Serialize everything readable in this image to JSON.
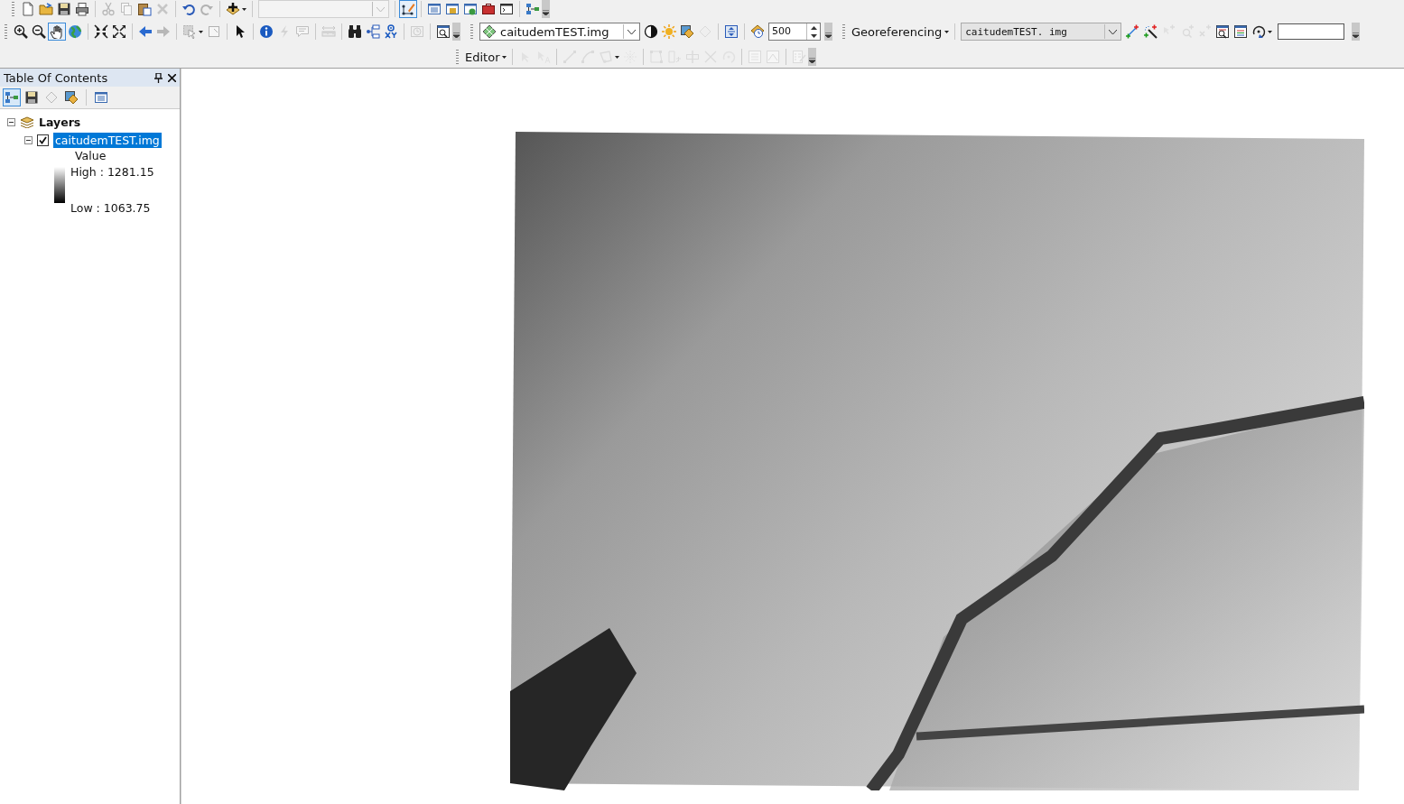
{
  "toolbars": [
    {
      "items": [
        {
          "kind": "grip"
        },
        {
          "kind": "tool",
          "disabled": false,
          "selected": false
        },
        {
          "kind": "tool",
          "disabled": false,
          "selected": false
        },
        {
          "kind": "tool",
          "disabled": false,
          "selected": false
        },
        {
          "kind": "tool",
          "disabled": false,
          "selected": false
        },
        {
          "kind": "sep"
        },
        {
          "kind": "tool",
          "disabled": true,
          "selected": false
        },
        {
          "kind": "tool",
          "disabled": true,
          "selected": false
        },
        {
          "kind": "tool",
          "disabled": false,
          "selected": false
        },
        {
          "kind": "tool",
          "disabled": true,
          "selected": false
        },
        {
          "kind": "sep"
        },
        {
          "kind": "tool",
          "disabled": false,
          "selected": false
        },
        {
          "kind": "tool",
          "disabled": true,
          "selected": false
        },
        {
          "kind": "sep"
        },
        {
          "kind": "dropdown-tool",
          "disabled": false,
          "selected": false
        },
        {
          "kind": "sep"
        },
        {
          "kind": "combo",
          "disabled": true
        },
        {
          "kind": "sep"
        },
        {
          "kind": "tool",
          "disabled": false,
          "selected": true
        },
        {
          "kind": "sep"
        },
        {
          "kind": "tool",
          "disabled": false,
          "selected": false
        },
        {
          "kind": "tool",
          "disabled": false,
          "selected": false
        },
        {
          "kind": "tool",
          "disabled": false,
          "selected": false
        },
        {
          "kind": "tool",
          "disabled": false,
          "selected": false
        },
        {
          "kind": "tool",
          "disabled": false,
          "selected": false
        },
        {
          "kind": "sep"
        },
        {
          "kind": "tool",
          "disabled": false,
          "selected": false
        },
        {
          "kind": "overflow"
        }
      ]
    },
    {
      "items": [
        {
          "kind": "grip"
        },
        {
          "kind": "tool",
          "disabled": false,
          "selected": false
        },
        {
          "kind": "tool",
          "disabled": false,
          "selected": false
        },
        {
          "kind": "tool",
          "disabled": false,
          "selected": true
        },
        {
          "kind": "tool",
          "disabled": false,
          "selected": false
        },
        {
          "kind": "sep"
        },
        {
          "kind": "tool",
          "disabled": false,
          "selected": false
        },
        {
          "kind": "tool",
          "disabled": false,
          "selected": false
        },
        {
          "kind": "sep"
        },
        {
          "kind": "tool",
          "disabled": false,
          "selected": false
        },
        {
          "kind": "tool",
          "disabled": true,
          "selected": false
        },
        {
          "kind": "sep"
        },
        {
          "kind": "dropdown-tool",
          "disabled": true,
          "selected": false
        },
        {
          "kind": "tool",
          "disabled": true,
          "selected": false
        },
        {
          "kind": "sep"
        },
        {
          "kind": "tool",
          "disabled": false,
          "selected": false
        },
        {
          "kind": "sep"
        },
        {
          "kind": "tool",
          "disabled": false,
          "selected": false
        },
        {
          "kind": "tool",
          "disabled": true,
          "selected": false
        },
        {
          "kind": "tool",
          "disabled": true,
          "selected": false
        },
        {
          "kind": "sep"
        },
        {
          "kind": "tool",
          "disabled": true,
          "selected": false
        },
        {
          "kind": "sep"
        },
        {
          "kind": "tool",
          "disabled": false,
          "selected": false
        },
        {
          "kind": "tool",
          "disabled": false,
          "selected": false
        },
        {
          "kind": "tool",
          "disabled": false,
          "selected": false
        },
        {
          "kind": "sep"
        },
        {
          "kind": "tool",
          "disabled": true,
          "selected": false
        },
        {
          "kind": "sep"
        },
        {
          "kind": "tool",
          "disabled": false,
          "selected": false
        },
        {
          "kind": "overflow"
        },
        {
          "kind": "grip"
        },
        {
          "kind": "combo",
          "disabled": false,
          "value": "caitudemTEST.img"
        },
        {
          "kind": "tool",
          "disabled": false,
          "selected": false
        },
        {
          "kind": "tool",
          "disabled": false,
          "selected": false
        },
        {
          "kind": "tool",
          "disabled": false,
          "selected": false
        },
        {
          "kind": "tool",
          "disabled": true,
          "selected": false
        },
        {
          "kind": "sep"
        },
        {
          "kind": "tool",
          "disabled": false,
          "selected": false
        },
        {
          "kind": "sep"
        },
        {
          "kind": "tool",
          "disabled": false,
          "selected": false
        },
        {
          "kind": "spin",
          "value": "500"
        },
        {
          "kind": "overflow"
        },
        {
          "kind": "grip"
        },
        {
          "kind": "menu",
          "label": "Georeferencing"
        },
        {
          "kind": "sep"
        },
        {
          "kind": "combo",
          "disabled": false,
          "value": "caitudemTEST. img"
        },
        {
          "kind": "tool",
          "disabled": false,
          "selected": false
        },
        {
          "kind": "tool",
          "disabled": false,
          "selected": false
        },
        {
          "kind": "tool",
          "disabled": true,
          "selected": false
        },
        {
          "kind": "tool",
          "disabled": true,
          "selected": false
        },
        {
          "kind": "tool",
          "disabled": true,
          "selected": false
        },
        {
          "kind": "tool",
          "disabled": false,
          "selected": false
        },
        {
          "kind": "tool",
          "disabled": false,
          "selected": false
        },
        {
          "kind": "dropdown-tool",
          "disabled": false,
          "selected": false
        },
        {
          "kind": "field"
        },
        {
          "kind": "overflow"
        }
      ]
    },
    {
      "items": [
        {
          "kind": "grip"
        },
        {
          "kind": "menu",
          "label": "Editor"
        },
        {
          "kind": "sep"
        },
        {
          "kind": "tool",
          "disabled": true,
          "selected": false
        },
        {
          "kind": "tool",
          "disabled": true,
          "selected": false
        },
        {
          "kind": "sep"
        },
        {
          "kind": "tool",
          "disabled": true,
          "selected": false
        },
        {
          "kind": "tool",
          "disabled": true,
          "selected": false
        },
        {
          "kind": "dropdown-tool",
          "disabled": true,
          "selected": false
        },
        {
          "kind": "tool",
          "disabled": true,
          "selected": false
        },
        {
          "kind": "sep"
        },
        {
          "kind": "tool",
          "disabled": true,
          "selected": false
        },
        {
          "kind": "tool",
          "disabled": true,
          "selected": false
        },
        {
          "kind": "tool",
          "disabled": true,
          "selected": false
        },
        {
          "kind": "tool",
          "disabled": true,
          "selected": false
        },
        {
          "kind": "tool",
          "disabled": true,
          "selected": false
        },
        {
          "kind": "sep"
        },
        {
          "kind": "tool",
          "disabled": true,
          "selected": false
        },
        {
          "kind": "tool",
          "disabled": true,
          "selected": false
        },
        {
          "kind": "sep"
        },
        {
          "kind": "tool",
          "disabled": true,
          "selected": false
        },
        {
          "kind": "overflow"
        }
      ]
    }
  ],
  "toc": {
    "title": "Table Of Contents",
    "views": [
      {
        "selected": true
      },
      {
        "selected": false
      },
      {
        "selected": false
      },
      {
        "selected": false
      },
      {
        "selected": false
      }
    ],
    "tree": [
      {
        "label": "Layers",
        "expanded": true,
        "children": [
          {
            "label": "caitudemTEST.img",
            "expanded": true,
            "checked": true,
            "selected": true,
            "legend": {
              "heading": "Value",
              "high": "High : 1281.15",
              "low": "Low : 1063.75"
            }
          }
        ]
      }
    ]
  }
}
